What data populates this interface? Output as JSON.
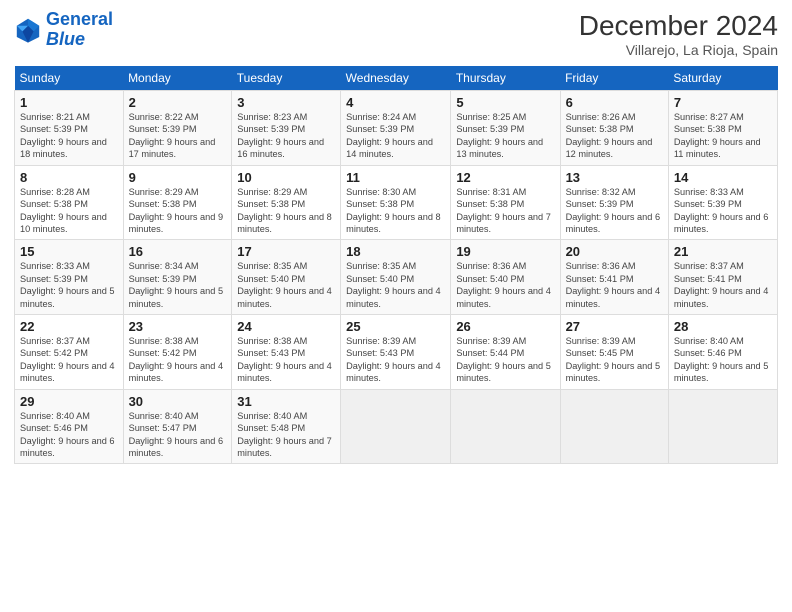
{
  "header": {
    "logo_line1": "General",
    "logo_line2": "Blue",
    "title": "December 2024",
    "subtitle": "Villarejo, La Rioja, Spain"
  },
  "columns": [
    "Sunday",
    "Monday",
    "Tuesday",
    "Wednesday",
    "Thursday",
    "Friday",
    "Saturday"
  ],
  "weeks": [
    [
      {
        "day": "1",
        "sunrise": "8:21 AM",
        "sunset": "5:39 PM",
        "daylight": "9 hours and 18 minutes."
      },
      {
        "day": "2",
        "sunrise": "8:22 AM",
        "sunset": "5:39 PM",
        "daylight": "9 hours and 17 minutes."
      },
      {
        "day": "3",
        "sunrise": "8:23 AM",
        "sunset": "5:39 PM",
        "daylight": "9 hours and 16 minutes."
      },
      {
        "day": "4",
        "sunrise": "8:24 AM",
        "sunset": "5:39 PM",
        "daylight": "9 hours and 14 minutes."
      },
      {
        "day": "5",
        "sunrise": "8:25 AM",
        "sunset": "5:39 PM",
        "daylight": "9 hours and 13 minutes."
      },
      {
        "day": "6",
        "sunrise": "8:26 AM",
        "sunset": "5:38 PM",
        "daylight": "9 hours and 12 minutes."
      },
      {
        "day": "7",
        "sunrise": "8:27 AM",
        "sunset": "5:38 PM",
        "daylight": "9 hours and 11 minutes."
      }
    ],
    [
      {
        "day": "8",
        "sunrise": "8:28 AM",
        "sunset": "5:38 PM",
        "daylight": "9 hours and 10 minutes."
      },
      {
        "day": "9",
        "sunrise": "8:29 AM",
        "sunset": "5:38 PM",
        "daylight": "9 hours and 9 minutes."
      },
      {
        "day": "10",
        "sunrise": "8:29 AM",
        "sunset": "5:38 PM",
        "daylight": "9 hours and 8 minutes."
      },
      {
        "day": "11",
        "sunrise": "8:30 AM",
        "sunset": "5:38 PM",
        "daylight": "9 hours and 8 minutes."
      },
      {
        "day": "12",
        "sunrise": "8:31 AM",
        "sunset": "5:38 PM",
        "daylight": "9 hours and 7 minutes."
      },
      {
        "day": "13",
        "sunrise": "8:32 AM",
        "sunset": "5:39 PM",
        "daylight": "9 hours and 6 minutes."
      },
      {
        "day": "14",
        "sunrise": "8:33 AM",
        "sunset": "5:39 PM",
        "daylight": "9 hours and 6 minutes."
      }
    ],
    [
      {
        "day": "15",
        "sunrise": "8:33 AM",
        "sunset": "5:39 PM",
        "daylight": "9 hours and 5 minutes."
      },
      {
        "day": "16",
        "sunrise": "8:34 AM",
        "sunset": "5:39 PM",
        "daylight": "9 hours and 5 minutes."
      },
      {
        "day": "17",
        "sunrise": "8:35 AM",
        "sunset": "5:40 PM",
        "daylight": "9 hours and 4 minutes."
      },
      {
        "day": "18",
        "sunrise": "8:35 AM",
        "sunset": "5:40 PM",
        "daylight": "9 hours and 4 minutes."
      },
      {
        "day": "19",
        "sunrise": "8:36 AM",
        "sunset": "5:40 PM",
        "daylight": "9 hours and 4 minutes."
      },
      {
        "day": "20",
        "sunrise": "8:36 AM",
        "sunset": "5:41 PM",
        "daylight": "9 hours and 4 minutes."
      },
      {
        "day": "21",
        "sunrise": "8:37 AM",
        "sunset": "5:41 PM",
        "daylight": "9 hours and 4 minutes."
      }
    ],
    [
      {
        "day": "22",
        "sunrise": "8:37 AM",
        "sunset": "5:42 PM",
        "daylight": "9 hours and 4 minutes."
      },
      {
        "day": "23",
        "sunrise": "8:38 AM",
        "sunset": "5:42 PM",
        "daylight": "9 hours and 4 minutes."
      },
      {
        "day": "24",
        "sunrise": "8:38 AM",
        "sunset": "5:43 PM",
        "daylight": "9 hours and 4 minutes."
      },
      {
        "day": "25",
        "sunrise": "8:39 AM",
        "sunset": "5:43 PM",
        "daylight": "9 hours and 4 minutes."
      },
      {
        "day": "26",
        "sunrise": "8:39 AM",
        "sunset": "5:44 PM",
        "daylight": "9 hours and 5 minutes."
      },
      {
        "day": "27",
        "sunrise": "8:39 AM",
        "sunset": "5:45 PM",
        "daylight": "9 hours and 5 minutes."
      },
      {
        "day": "28",
        "sunrise": "8:40 AM",
        "sunset": "5:46 PM",
        "daylight": "9 hours and 5 minutes."
      }
    ],
    [
      {
        "day": "29",
        "sunrise": "8:40 AM",
        "sunset": "5:46 PM",
        "daylight": "9 hours and 6 minutes."
      },
      {
        "day": "30",
        "sunrise": "8:40 AM",
        "sunset": "5:47 PM",
        "daylight": "9 hours and 6 minutes."
      },
      {
        "day": "31",
        "sunrise": "8:40 AM",
        "sunset": "5:48 PM",
        "daylight": "9 hours and 7 minutes."
      },
      null,
      null,
      null,
      null
    ]
  ]
}
